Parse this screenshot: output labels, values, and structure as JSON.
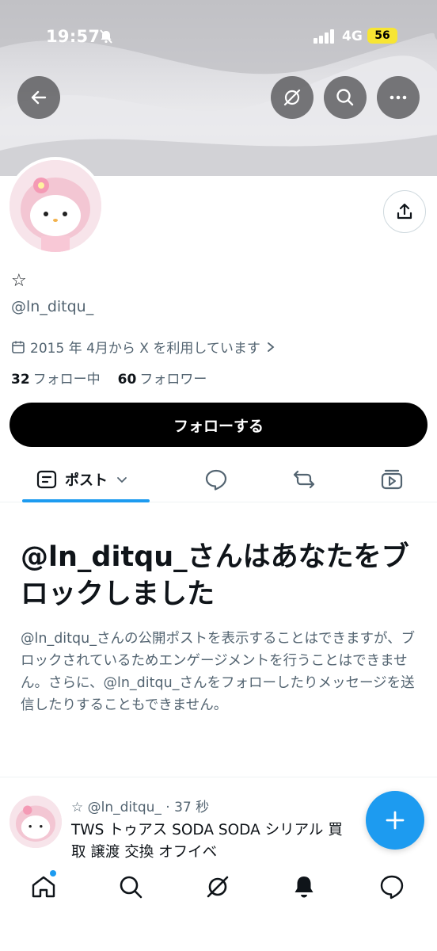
{
  "status_bar": {
    "time": "19:57",
    "network": "4G",
    "battery": "56"
  },
  "header": {
    "back_icon": "arrow-left-icon",
    "grok_icon": "grok-icon",
    "search_icon": "search-icon",
    "more_icon": "more-horizontal-icon"
  },
  "profile": {
    "display_name": "☆",
    "handle": "@ln_ditqu_",
    "joined": "2015 年 4月から X を利用しています",
    "following_count": "32",
    "following_label": "フォロー中",
    "followers_count": "60",
    "followers_label": "フォロワー",
    "follow_button": "フォローする"
  },
  "tabs": {
    "posts_label": "ポスト",
    "icons": [
      "posts-icon",
      "reply-icon",
      "repost-icon",
      "media-icon"
    ]
  },
  "blocked": {
    "title": "@ln_ditqu_さんはあなたをブロックしました",
    "body": "@ln_ditqu_さんの公開ポストを表示することはできますが、ブロックされているためエンゲージメントを行うことはできません。さらに、@ln_ditqu_さんをフォローしたりメッセージを送信したりすることもできません。"
  },
  "post": {
    "author": "☆ @ln_ditqu_ · 37 秒",
    "text": "TWS トゥアス  SODA SODA シリアル 買取 譲渡 交換 オフイベ"
  },
  "colors": {
    "accent": "#1d9bf0",
    "text": "#0f1419",
    "muted": "#536471"
  },
  "bottom_nav": [
    "home-icon",
    "search-icon",
    "grok-icon",
    "notifications-icon",
    "messages-icon"
  ]
}
